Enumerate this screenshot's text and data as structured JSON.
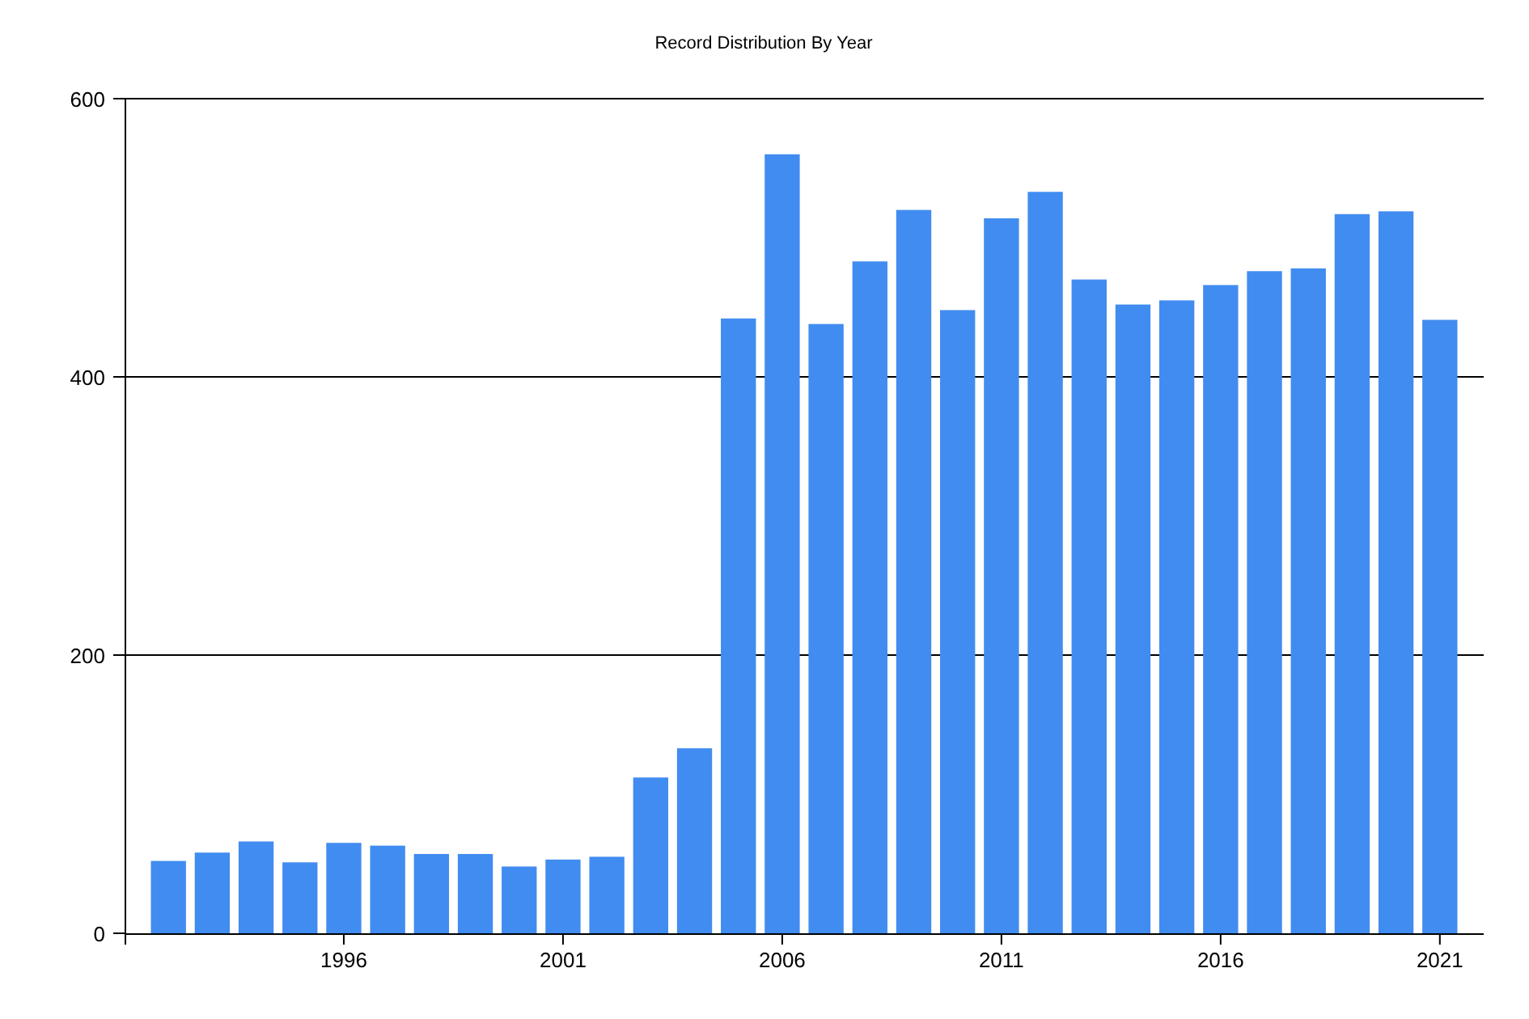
{
  "chart_data": {
    "type": "bar",
    "title": "Record Distribution By Year",
    "x": [
      1992,
      1993,
      1994,
      1995,
      1996,
      1997,
      1998,
      1999,
      2000,
      2001,
      2002,
      2003,
      2004,
      2005,
      2006,
      2007,
      2008,
      2009,
      2010,
      2011,
      2012,
      2013,
      2014,
      2015,
      2016,
      2017,
      2018,
      2019,
      2020,
      2021
    ],
    "series": [
      {
        "color": "#418cf0",
        "values": [
          52,
          58,
          66,
          51,
          65,
          63,
          57,
          57,
          48,
          53,
          55,
          112,
          133,
          442,
          560,
          438,
          483,
          520,
          448,
          514,
          533,
          470,
          452,
          455,
          466,
          476,
          478,
          517,
          519,
          441
        ]
      }
    ],
    "xlim": [
      1991,
      2022
    ],
    "ylim": [
      0,
      600
    ],
    "xticks": [
      1996,
      2001,
      2006,
      2011,
      2016,
      2021
    ],
    "yticks": [
      0,
      200,
      400,
      600
    ]
  }
}
